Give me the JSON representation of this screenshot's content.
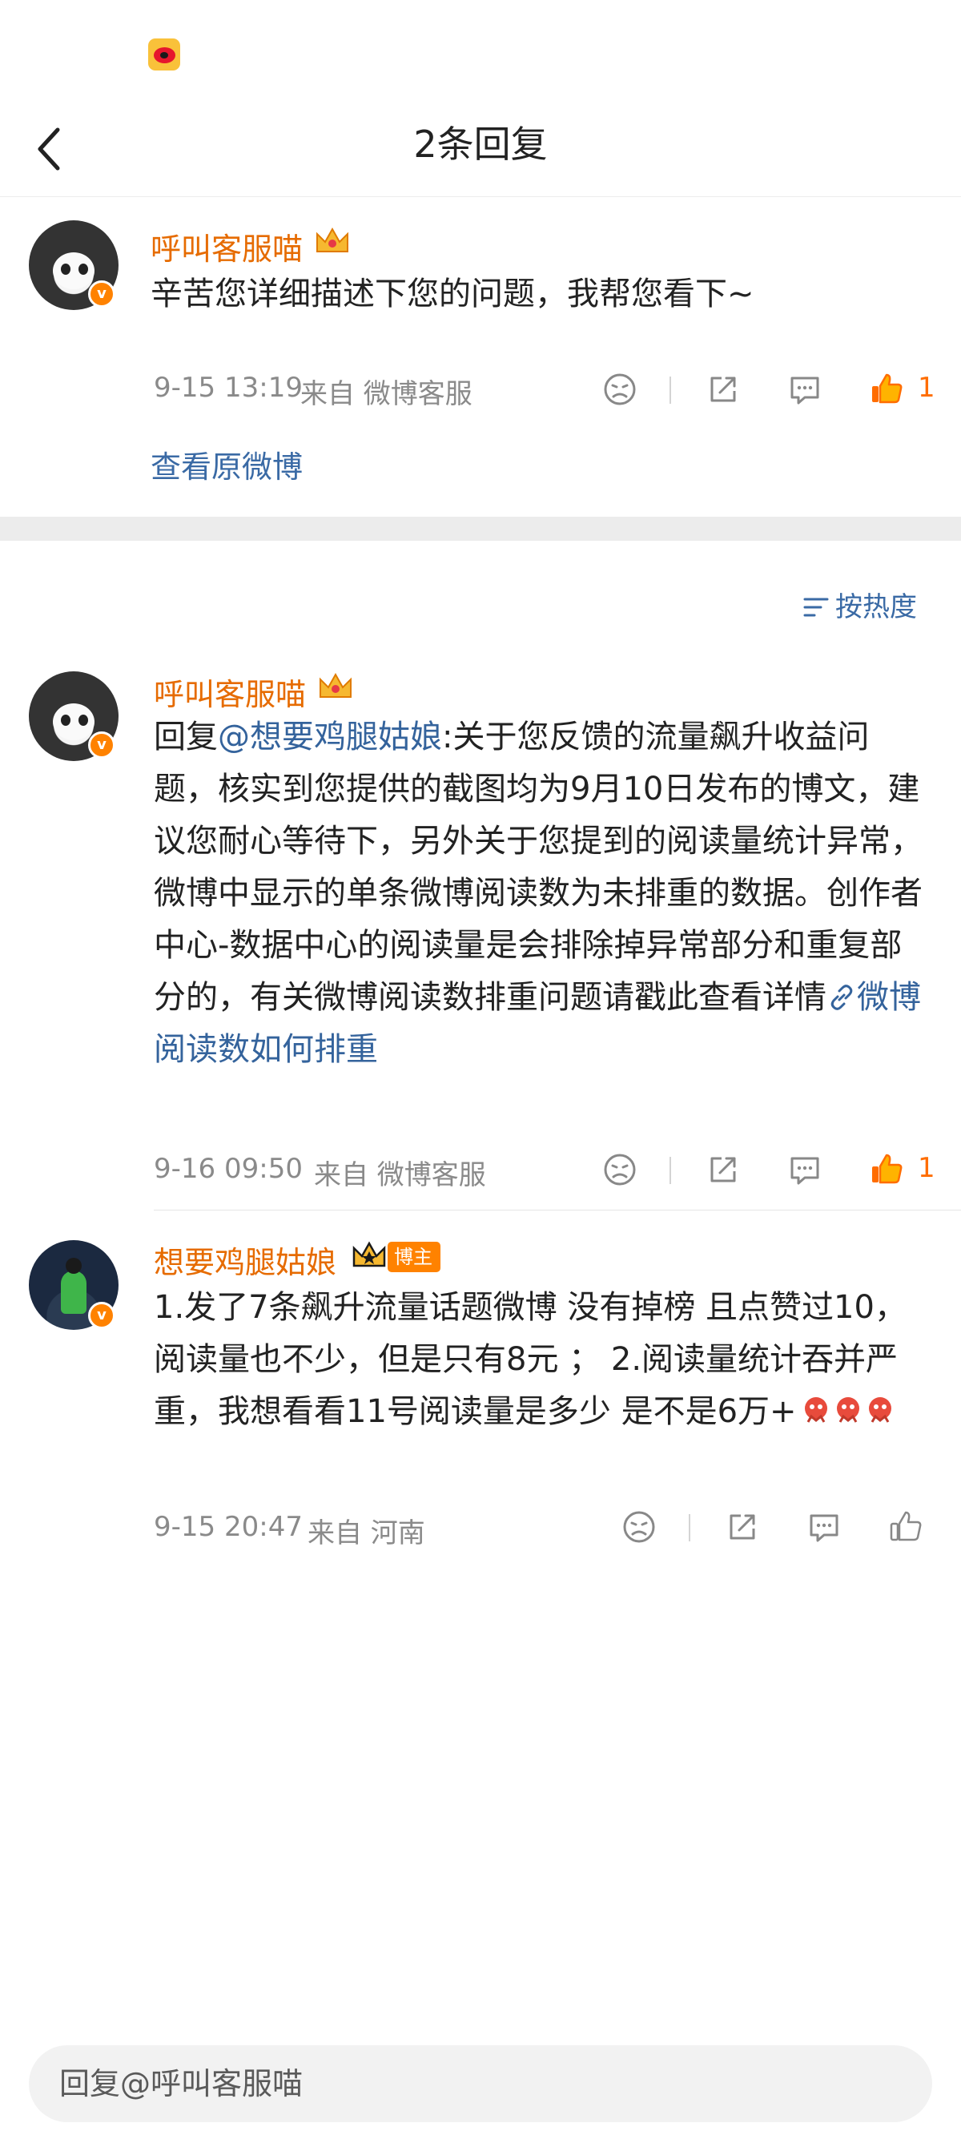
{
  "nav": {
    "title": "2条回复"
  },
  "colors": {
    "username": "#e66b00",
    "link": "#34639c",
    "like_active": "#ff6d00",
    "vip_badge": "#ff8200"
  },
  "main_comment": {
    "username": "呼叫客服喵",
    "text": "辛苦您详细描述下您的问题，我帮您看下~",
    "timestamp": "9-15 13:19",
    "source": "来自 微博客服",
    "like_count": "1",
    "view_original": "查看原微博"
  },
  "sort": {
    "label": "按热度"
  },
  "replies": [
    {
      "username": "呼叫客服喵",
      "reply_prefix": "回复",
      "mention": "@想要鸡腿姑娘",
      "text": ":关于您反馈的流量飙升收益问题，核实到您提供的截图均为9月10日发布的博文，建议您耐心等待下，另外关于您提到的阅读量统计异常，微博中显示的单条微博阅读数为未排重的数据。创作者中心-数据中心的阅读量是会排除掉异常部分和重复部分的，有关微博阅读数排重问题请戳此查看详情",
      "link_text": "微博阅读数如何排重",
      "timestamp": "9-16 09:50",
      "source": "来自 微博客服",
      "like_count": "1"
    },
    {
      "username": "想要鸡腿姑娘",
      "badge": "博主",
      "text": "1.发了7条飙升流量话题微博 没有掉榜 且点赞过10，阅读量也不少，但是只有8元 ； 2.阅读量统计吞并严重，我想看看11号阅读量是多少 是不是6万+",
      "timestamp": "9-15 20:47",
      "source": "来自 河南"
    }
  ],
  "reply_input": {
    "placeholder": "回复@呼叫客服喵"
  },
  "icons": [
    "weibo-logo-icon",
    "back-icon",
    "crown-icon",
    "dislike-icon",
    "share-icon",
    "comment-icon",
    "like-icon",
    "link-icon",
    "sort-icon",
    "emoji-icon"
  ]
}
